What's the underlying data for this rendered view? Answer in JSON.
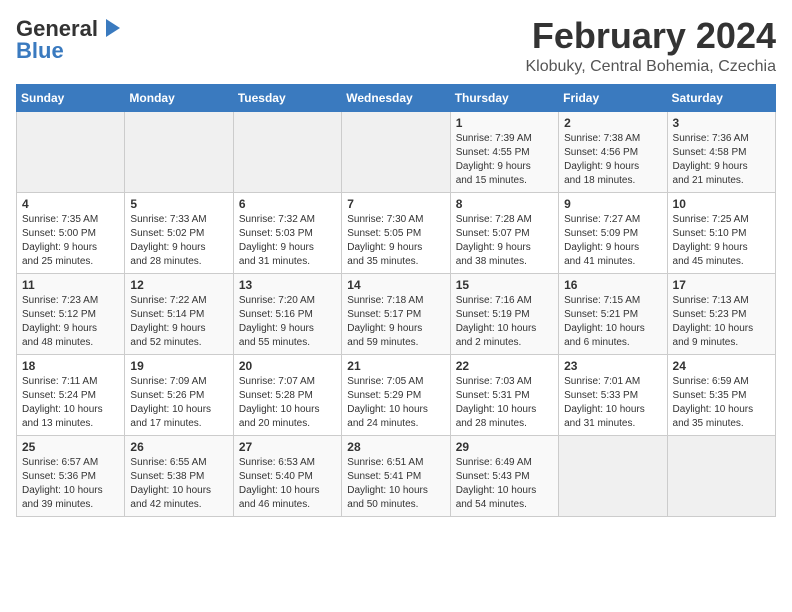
{
  "app": {
    "name_general": "General",
    "name_blue": "Blue"
  },
  "calendar": {
    "title": "February 2024",
    "subtitle": "Klobuky, Central Bohemia, Czechia",
    "days_of_week": [
      "Sunday",
      "Monday",
      "Tuesday",
      "Wednesday",
      "Thursday",
      "Friday",
      "Saturday"
    ],
    "weeks": [
      [
        {
          "day": "",
          "content": ""
        },
        {
          "day": "",
          "content": ""
        },
        {
          "day": "",
          "content": ""
        },
        {
          "day": "",
          "content": ""
        },
        {
          "day": "1",
          "content": "Sunrise: 7:39 AM\nSunset: 4:55 PM\nDaylight: 9 hours\nand 15 minutes."
        },
        {
          "day": "2",
          "content": "Sunrise: 7:38 AM\nSunset: 4:56 PM\nDaylight: 9 hours\nand 18 minutes."
        },
        {
          "day": "3",
          "content": "Sunrise: 7:36 AM\nSunset: 4:58 PM\nDaylight: 9 hours\nand 21 minutes."
        }
      ],
      [
        {
          "day": "4",
          "content": "Sunrise: 7:35 AM\nSunset: 5:00 PM\nDaylight: 9 hours\nand 25 minutes."
        },
        {
          "day": "5",
          "content": "Sunrise: 7:33 AM\nSunset: 5:02 PM\nDaylight: 9 hours\nand 28 minutes."
        },
        {
          "day": "6",
          "content": "Sunrise: 7:32 AM\nSunset: 5:03 PM\nDaylight: 9 hours\nand 31 minutes."
        },
        {
          "day": "7",
          "content": "Sunrise: 7:30 AM\nSunset: 5:05 PM\nDaylight: 9 hours\nand 35 minutes."
        },
        {
          "day": "8",
          "content": "Sunrise: 7:28 AM\nSunset: 5:07 PM\nDaylight: 9 hours\nand 38 minutes."
        },
        {
          "day": "9",
          "content": "Sunrise: 7:27 AM\nSunset: 5:09 PM\nDaylight: 9 hours\nand 41 minutes."
        },
        {
          "day": "10",
          "content": "Sunrise: 7:25 AM\nSunset: 5:10 PM\nDaylight: 9 hours\nand 45 minutes."
        }
      ],
      [
        {
          "day": "11",
          "content": "Sunrise: 7:23 AM\nSunset: 5:12 PM\nDaylight: 9 hours\nand 48 minutes."
        },
        {
          "day": "12",
          "content": "Sunrise: 7:22 AM\nSunset: 5:14 PM\nDaylight: 9 hours\nand 52 minutes."
        },
        {
          "day": "13",
          "content": "Sunrise: 7:20 AM\nSunset: 5:16 PM\nDaylight: 9 hours\nand 55 minutes."
        },
        {
          "day": "14",
          "content": "Sunrise: 7:18 AM\nSunset: 5:17 PM\nDaylight: 9 hours\nand 59 minutes."
        },
        {
          "day": "15",
          "content": "Sunrise: 7:16 AM\nSunset: 5:19 PM\nDaylight: 10 hours\nand 2 minutes."
        },
        {
          "day": "16",
          "content": "Sunrise: 7:15 AM\nSunset: 5:21 PM\nDaylight: 10 hours\nand 6 minutes."
        },
        {
          "day": "17",
          "content": "Sunrise: 7:13 AM\nSunset: 5:23 PM\nDaylight: 10 hours\nand 9 minutes."
        }
      ],
      [
        {
          "day": "18",
          "content": "Sunrise: 7:11 AM\nSunset: 5:24 PM\nDaylight: 10 hours\nand 13 minutes."
        },
        {
          "day": "19",
          "content": "Sunrise: 7:09 AM\nSunset: 5:26 PM\nDaylight: 10 hours\nand 17 minutes."
        },
        {
          "day": "20",
          "content": "Sunrise: 7:07 AM\nSunset: 5:28 PM\nDaylight: 10 hours\nand 20 minutes."
        },
        {
          "day": "21",
          "content": "Sunrise: 7:05 AM\nSunset: 5:29 PM\nDaylight: 10 hours\nand 24 minutes."
        },
        {
          "day": "22",
          "content": "Sunrise: 7:03 AM\nSunset: 5:31 PM\nDaylight: 10 hours\nand 28 minutes."
        },
        {
          "day": "23",
          "content": "Sunrise: 7:01 AM\nSunset: 5:33 PM\nDaylight: 10 hours\nand 31 minutes."
        },
        {
          "day": "24",
          "content": "Sunrise: 6:59 AM\nSunset: 5:35 PM\nDaylight: 10 hours\nand 35 minutes."
        }
      ],
      [
        {
          "day": "25",
          "content": "Sunrise: 6:57 AM\nSunset: 5:36 PM\nDaylight: 10 hours\nand 39 minutes."
        },
        {
          "day": "26",
          "content": "Sunrise: 6:55 AM\nSunset: 5:38 PM\nDaylight: 10 hours\nand 42 minutes."
        },
        {
          "day": "27",
          "content": "Sunrise: 6:53 AM\nSunset: 5:40 PM\nDaylight: 10 hours\nand 46 minutes."
        },
        {
          "day": "28",
          "content": "Sunrise: 6:51 AM\nSunset: 5:41 PM\nDaylight: 10 hours\nand 50 minutes."
        },
        {
          "day": "29",
          "content": "Sunrise: 6:49 AM\nSunset: 5:43 PM\nDaylight: 10 hours\nand 54 minutes."
        },
        {
          "day": "",
          "content": ""
        },
        {
          "day": "",
          "content": ""
        }
      ]
    ]
  }
}
